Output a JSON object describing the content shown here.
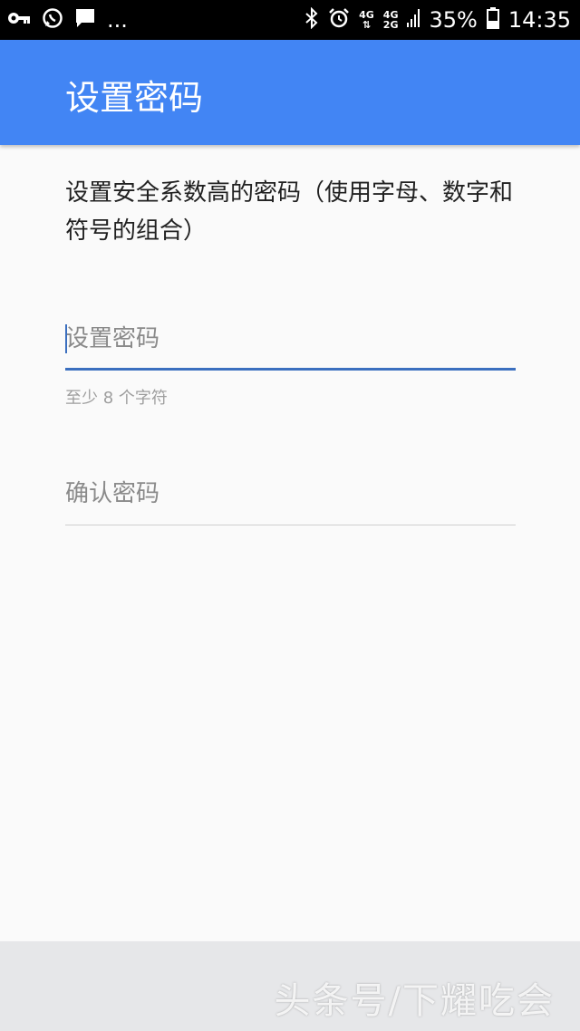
{
  "status_bar": {
    "icons_left": [
      "key-icon",
      "whatsapp-icon",
      "message-icon"
    ],
    "more": "...",
    "network_top": "4G",
    "network_bottom": "2G",
    "battery": "35%",
    "time": "14:35"
  },
  "app_bar": {
    "title": "设置密码"
  },
  "description": "设置安全系数高的密码（使用字母、数字和符号的组合）",
  "password_field": {
    "placeholder": "设置密码",
    "value": ""
  },
  "helper_text": "至少 8 个字符",
  "confirm_field": {
    "placeholder": "确认密码",
    "value": ""
  },
  "watermark": "头条号/下耀吃会",
  "colors": {
    "app_bar": "#4285f4",
    "focus_line": "#3b6fbf",
    "background": "#fafafa"
  }
}
